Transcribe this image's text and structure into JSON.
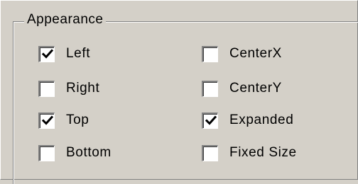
{
  "group": {
    "title": "Appearance"
  },
  "options": [
    {
      "label": "Left",
      "checked": true
    },
    {
      "label": "Right",
      "checked": false
    },
    {
      "label": "Top",
      "checked": true
    },
    {
      "label": "Bottom",
      "checked": false
    },
    {
      "label": "CenterX",
      "checked": false
    },
    {
      "label": "CenterY",
      "checked": false
    },
    {
      "label": "Expanded",
      "checked": true
    },
    {
      "label": "Fixed Size",
      "checked": false
    }
  ]
}
